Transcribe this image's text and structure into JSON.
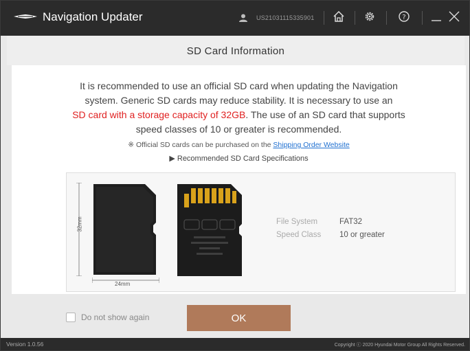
{
  "window": {
    "title": "Navigation Updater",
    "user_id": "US21031115335901"
  },
  "header": {
    "title": "SD Card Information"
  },
  "main": {
    "line1": "It is recommended to use an official SD card when updating the Navigation",
    "line2": "system. Generic SD cards may reduce stability. It is necessary to use an",
    "line3_red": "SD card with a storage capacity of 32GB",
    "line3_rest": ". The use of an SD card that supports",
    "line4": "speed classes of 10 or greater is recommended.",
    "note_prefix": "※ Official SD cards can be purchased on the ",
    "note_link": "Shipping Order Website",
    "recommended": "▶ Recommended SD Card Specifications"
  },
  "spec": {
    "height_label": "32mm",
    "width_label": "24mm",
    "rows": [
      {
        "label": "File System",
        "value": "FAT32"
      },
      {
        "label": "Speed Class",
        "value": "10 or greater"
      }
    ]
  },
  "footer": {
    "checkbox_label": "Do not show again",
    "ok_label": "OK"
  },
  "status": {
    "version": "Version 1.0.56",
    "copyright": "Copyright ⓒ 2020 Hyundai Motor Group All Rights Reserved."
  },
  "colors": {
    "titlebar": "#2b2b2b",
    "accent_button": "#b07a5a",
    "warning_text": "#e02020",
    "link": "#1e6fd0"
  },
  "icons": [
    "car-logo-icon",
    "user-icon",
    "home-icon",
    "settings-icon",
    "help-icon",
    "minimize-icon",
    "close-icon"
  ]
}
